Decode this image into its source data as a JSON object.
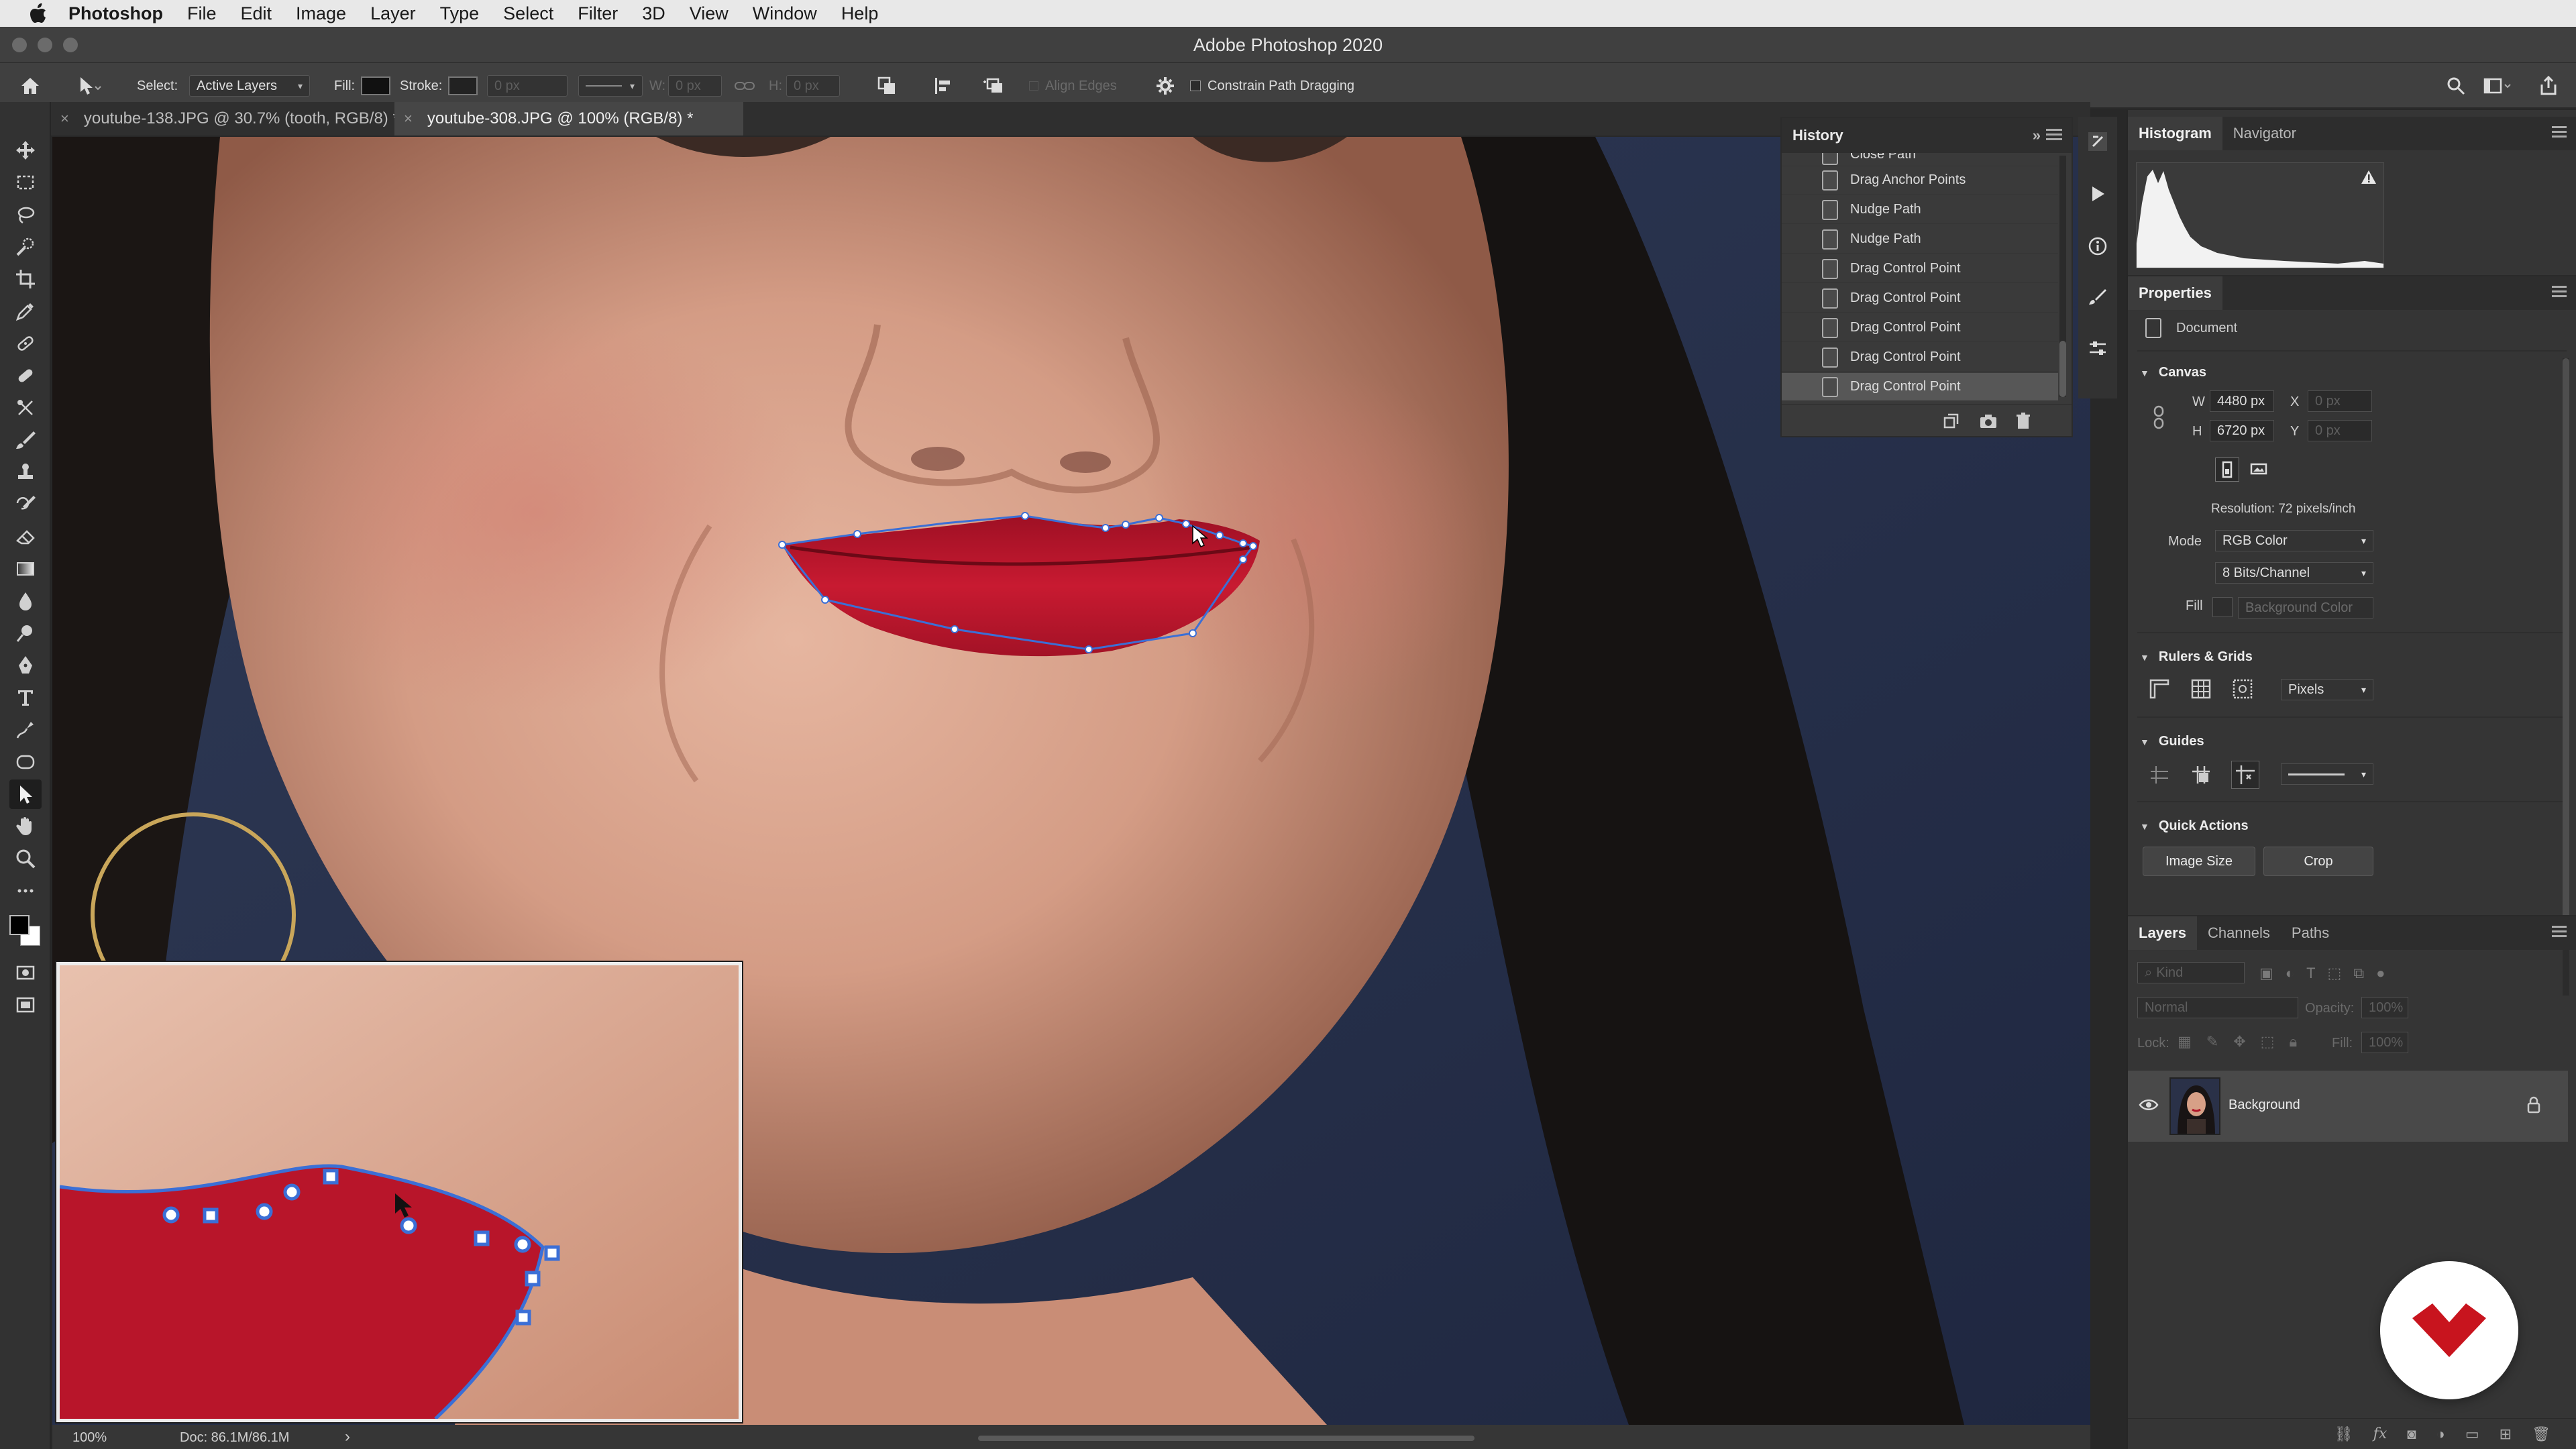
{
  "menubar": {
    "app": "Photoshop",
    "items": [
      "File",
      "Edit",
      "Image",
      "Layer",
      "Type",
      "Select",
      "Filter",
      "3D",
      "View",
      "Window",
      "Help"
    ]
  },
  "window": {
    "title": "Adobe Photoshop 2020"
  },
  "options": {
    "select_label": "Select:",
    "select_value": "Active Layers",
    "fill_label": "Fill:",
    "stroke_label": "Stroke:",
    "stroke_size": "0 px",
    "w_label": "W:",
    "w_value": "0 px",
    "h_label": "H:",
    "h_value": "0 px",
    "align_edges": "Align Edges",
    "constrain": "Constrain Path Dragging"
  },
  "tabs": [
    {
      "label": "youtube-138.JPG @ 30.7% (tooth, RGB/8) *",
      "active": false
    },
    {
      "label": "youtube-308.JPG @ 100% (RGB/8) *",
      "active": true
    }
  ],
  "history": {
    "title": "History",
    "partial_item": "Close Path",
    "items": [
      "Drag Anchor Points",
      "Nudge Path",
      "Nudge Path",
      "Drag Control Point",
      "Drag Control Point",
      "Drag Control Point",
      "Drag Control Point",
      "Drag Control Point"
    ],
    "selected_index": 7
  },
  "right_tabs": {
    "histogram": "Histogram",
    "navigator": "Navigator"
  },
  "properties": {
    "title": "Properties",
    "doc_label": "Document",
    "canvas_section": "Canvas",
    "w_label": "W",
    "w_value": "4480 px",
    "h_label": "H",
    "h_value": "6720 px",
    "x_label": "X",
    "x_value": "0 px",
    "y_label": "Y",
    "y_value": "0 px",
    "resolution": "Resolution: 72 pixels/inch",
    "mode_label": "Mode",
    "mode_value": "RGB Color",
    "bits_value": "8 Bits/Channel",
    "fill_label": "Fill",
    "fill_value": "Background Color",
    "rulers_section": "Rulers & Grids",
    "units_value": "Pixels",
    "guides_section": "Guides",
    "quick_section": "Quick Actions",
    "image_size_btn": "Image Size",
    "crop_btn": "Crop"
  },
  "layers": {
    "tabs": [
      "Layers",
      "Channels",
      "Paths"
    ],
    "kind_placeholder": "Kind",
    "blend": "Normal",
    "opacity_label": "Opacity:",
    "opacity_value": "100%",
    "lock_label": "Lock:",
    "fill_label": "Fill:",
    "fill_value": "100%",
    "layer_name": "Background"
  },
  "status": {
    "zoom": "100%",
    "doc": "Doc: 86.1M/86.1M",
    "arrow": "›"
  },
  "colors": {
    "accent_path": "#3b6fd6",
    "lip": "#b8152a",
    "badge": "#c8141e"
  }
}
